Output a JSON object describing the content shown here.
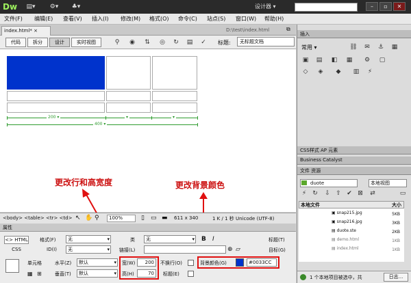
{
  "app": {
    "logo": "Dw",
    "workspace": "设计器 ▾",
    "icon_a": "▤▾",
    "icon_b": "⚙▾",
    "icon_c": "♣▾"
  },
  "menu": [
    "文件(F)",
    "编辑(E)",
    "查看(V)",
    "插入(I)",
    "修改(M)",
    "格式(O)",
    "命令(C)",
    "站点(S)",
    "窗口(W)",
    "帮助(H)"
  ],
  "document": {
    "tab": "index.html*",
    "path": "D:\\test\\index.html"
  },
  "toolbar": {
    "code": "代码",
    "split": "拆分",
    "design": "设计",
    "live": "实时视图",
    "title_label": "标题:",
    "title_value": "无标题文档"
  },
  "table": {
    "width_total": "400 ▾",
    "width_col": "200 ▾",
    "col2": "▾",
    "col3": "▾",
    "cell_color": "#0033CC"
  },
  "annotations": {
    "left": "更改行和高宽度",
    "right": "更改背景颜色"
  },
  "status": {
    "path": "<body> <table> <tr> <td>",
    "zoom": "100%",
    "size": "611 x 340",
    "info": "1 K / 1 秒  Unicode (UTF-8)"
  },
  "properties": {
    "title": "属性",
    "html_tab": "<> HTML",
    "css_tab": "CSS",
    "format_label": "格式(F)",
    "format_value": "无",
    "id_label": "ID(I)",
    "id_value": "无",
    "class_label": "类",
    "class_value": "无",
    "link_label": "链接(L)",
    "bold": "B",
    "italic": "I",
    "title_label": "标题(T)",
    "target_label": "目标(G)",
    "cell_label": "单元格",
    "horz_label": "水平(Z)",
    "horz_value": "默认",
    "vert_label": "垂直(T)",
    "vert_value": "默认",
    "width_label": "宽(W)",
    "width_value": "200",
    "height_label": "高(H)",
    "height_value": "70",
    "nowrap_label": "不换行(O)",
    "header_label": "标题(E)",
    "bg_label": "背景颜色(G)",
    "bg_value": "#0033CC"
  },
  "right_panel": {
    "insert_title": "插入",
    "common": "常用 ▾",
    "css_tabs": "CSS样式   AP 元素",
    "bc": "Business Catalyst",
    "files_tabs": "文件   资源",
    "site": "duote",
    "view": "本地视图",
    "col_local": "本地文件",
    "col_size": "大小",
    "files": [
      {
        "name": "snap215.jpg",
        "size": "5KB"
      },
      {
        "name": "snap216.jpg",
        "size": "3KB"
      },
      {
        "name": "duote.ste",
        "size": "2KB"
      },
      {
        "name": "demo.html",
        "size": "1KB"
      },
      {
        "name": "index.html",
        "size": "1KB"
      }
    ],
    "status": "1 个本地项目被选中，共",
    "log": "日志..."
  },
  "colors": {
    "accent_green": "#9ef25e",
    "annotation_red": "#cc1111",
    "cell_blue": "#0033cc"
  }
}
